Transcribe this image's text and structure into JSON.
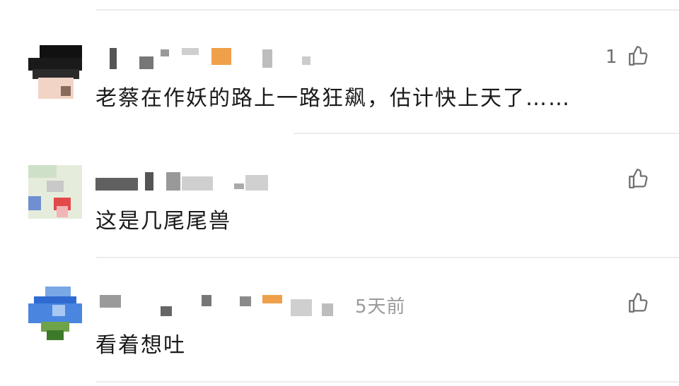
{
  "comments": [
    {
      "text": "老蔡在作妖的路上一路狂飙，估计快上天了……",
      "likes": "1",
      "time": ""
    },
    {
      "text": "这是几尾尾兽",
      "likes": "",
      "time": ""
    },
    {
      "text": "看着想吐",
      "likes": "",
      "time": "5天前"
    }
  ],
  "icons": {
    "like": "thumbs-up-outline-icon"
  }
}
